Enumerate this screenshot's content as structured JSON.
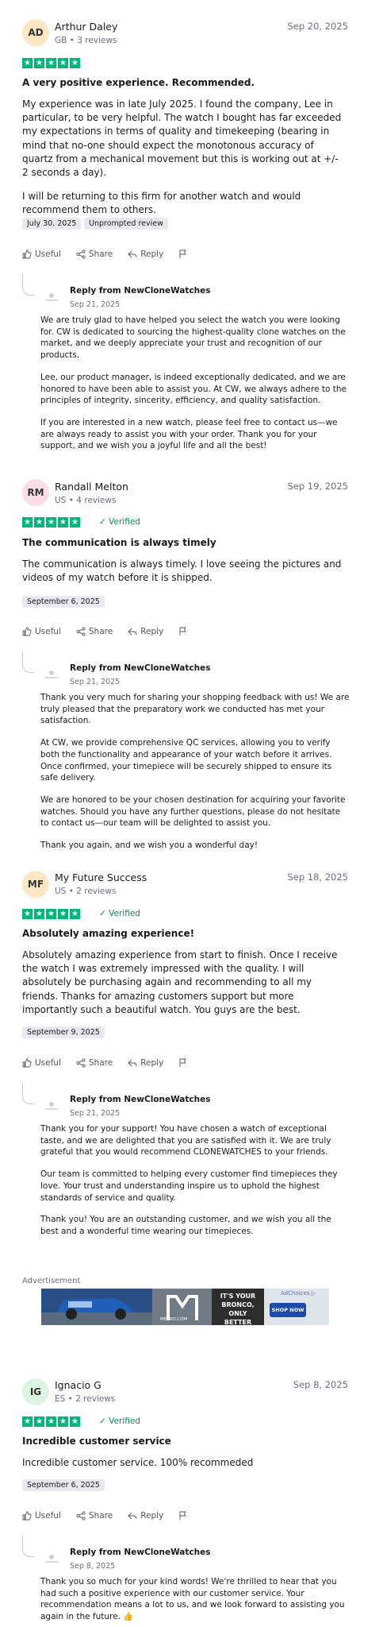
{
  "reviews": [
    {
      "initials": "AD",
      "avatar_color": "#fde6c4",
      "name": "Arthur Daley",
      "meta": "GB • 3 reviews",
      "date": "Sep 20, 2025",
      "verified": "",
      "title": "A very positive experience. Recommended.",
      "body": [
        "My experience was in late July 2025. I found the company, Lee in particular, to be very helpful. The watch I bought has far exceeded my expectations in terms of quality and timekeeping (bearing in mind that no-one should expect the monotonous accuracy of quartz from a mechanical movement but this is working out at +/- 2 seconds a day).",
        "I will be returning to this firm for another watch and would recommend them to others."
      ],
      "tags": [
        "July 30, 2025",
        "Unprompted review"
      ],
      "reply_from": "Reply from NewCloneWatches",
      "reply_date": "Sep 21, 2025",
      "reply": [
        "We are truly glad to have helped you select the watch you were looking for. CW is dedicated to sourcing the highest-quality clone watches on the market, and we deeply appreciate your trust and recognition of our products.",
        "Lee, our product manager, is indeed exceptionally dedicated, and we are honored to have been able to assist you. At CW, we always adhere to the principles of integrity, sincerity, efficiency, and quality satisfaction.",
        "If you are interested in a new watch, please feel free to contact us—we are always ready to assist you with your order. Thank you for your support, and we wish you a joyful life and all the best!"
      ]
    },
    {
      "initials": "RM",
      "avatar_color": "#fbdde6",
      "name": "Randall Melton",
      "meta": "US • 4 reviews",
      "date": "Sep 19, 2025",
      "verified": "Verified",
      "title": "The communication is always timely",
      "body": [
        "The communication is always timely. I love seeing the pictures and videos of my watch before it is shipped."
      ],
      "tags": [
        "September 6, 2025"
      ],
      "reply_from": "Reply from NewCloneWatches",
      "reply_date": "Sep 21, 2025",
      "reply": [
        "Thank you very much for sharing your shopping feedback with us! We are truly pleased that the preparatory work we conducted has met your satisfaction.",
        "At CW, we provide comprehensive QC services, allowing you to verify both the functionality and appearance of your watch before it arrives. Once confirmed, your timepiece will be securely shipped to ensure its safe delivery.",
        "We are honored to be your chosen destination for acquiring your favorite watches. Should you have any further questions, please do not hesitate to contact us—our team will be delighted to assist you.",
        "Thank you again, and we wish you a wonderful day!"
      ]
    },
    {
      "initials": "MF",
      "avatar_color": "#fde6c4",
      "name": "My Future Success",
      "meta": "US • 2 reviews",
      "date": "Sep 18, 2025",
      "verified": "Verified",
      "title": "Absolutely amazing experience!",
      "body": [
        "Absolutely amazing experience from start to finish. Once I receive the watch I was extremely impressed with the quality. I will absolutely be purchasing again and recommending to all my friends. Thanks for amazing customers support but more importantly such a beautiful watch. You guys are the best."
      ],
      "tags": [
        "September 9, 2025"
      ],
      "reply_from": "Reply from NewCloneWatches",
      "reply_date": "Sep 21, 2025",
      "reply": [
        "Thank you for your support! You have chosen a watch of exceptional taste, and we are delighted that you are satisfied with it. We are truly grateful that you would recommend CLONEWATCHES to your friends.",
        "Our team is committed to helping every customer find timepieces they love. Your trust and understanding inspire us to uphold the highest standards of service and quality.",
        "Thank you! You are an outstanding customer, and we wish you all the best and a wonderful time wearing our timepieces."
      ]
    },
    {
      "initials": "IG",
      "avatar_color": "#dcf5e0",
      "name": "Ignacio G",
      "meta": "ES • 2 reviews",
      "date": "Sep 8, 2025",
      "verified": "Verified",
      "title": "Incredible customer service",
      "body": [
        "Incredible customer service. 100% recommeded"
      ],
      "tags": [
        "September 6, 2025"
      ],
      "reply_from": "Reply from NewCloneWatches",
      "reply_date": "Sep 8, 2025",
      "reply": [
        "Thank you so much for your kind words! We're thrilled to hear that you had such a positive experience with our customer service. Your recommendation means a lot to us, and we look forward to assisting you again in the future. 👍"
      ]
    }
  ],
  "actions": {
    "useful": "Useful",
    "share": "Share",
    "reply": "Reply"
  },
  "ad": {
    "label": "Advertisement",
    "headline_1": "IT'S YOUR",
    "headline_2": "BRONCO,",
    "headline_3": "ONLY BETTER",
    "button": "SHOP NOW",
    "choices": "AdChoices",
    "site": "METRO.COM"
  },
  "colors": {
    "star": "#00b67a",
    "verified": "#118651",
    "muted": "#6c6c85"
  }
}
